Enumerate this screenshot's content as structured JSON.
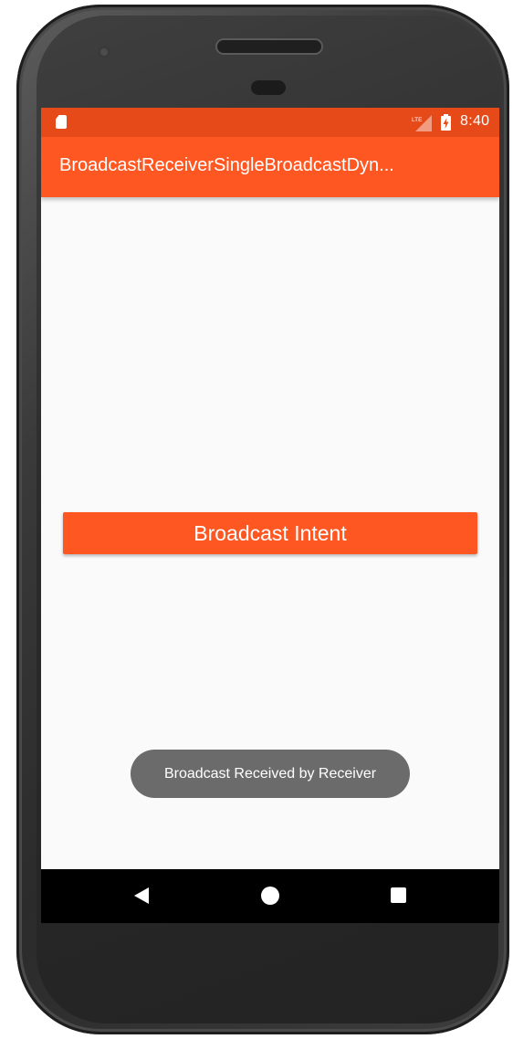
{
  "status_bar": {
    "time": "8:40",
    "network": "LTE",
    "icons": [
      "sd-card-icon",
      "lte-signal-icon",
      "battery-charging-icon"
    ]
  },
  "app_bar": {
    "title": "BroadcastReceiverSingleBroadcastDyn..."
  },
  "main": {
    "button_label": "Broadcast Intent"
  },
  "toast": {
    "message": "Broadcast Received by Receiver"
  },
  "nav_bar": {
    "icons": [
      "back-icon",
      "home-icon",
      "recents-icon"
    ]
  },
  "colors": {
    "primary": "#ff5722",
    "primary_dark": "#e64a19",
    "background": "#fafafa",
    "toast": "#6b6b6b"
  }
}
